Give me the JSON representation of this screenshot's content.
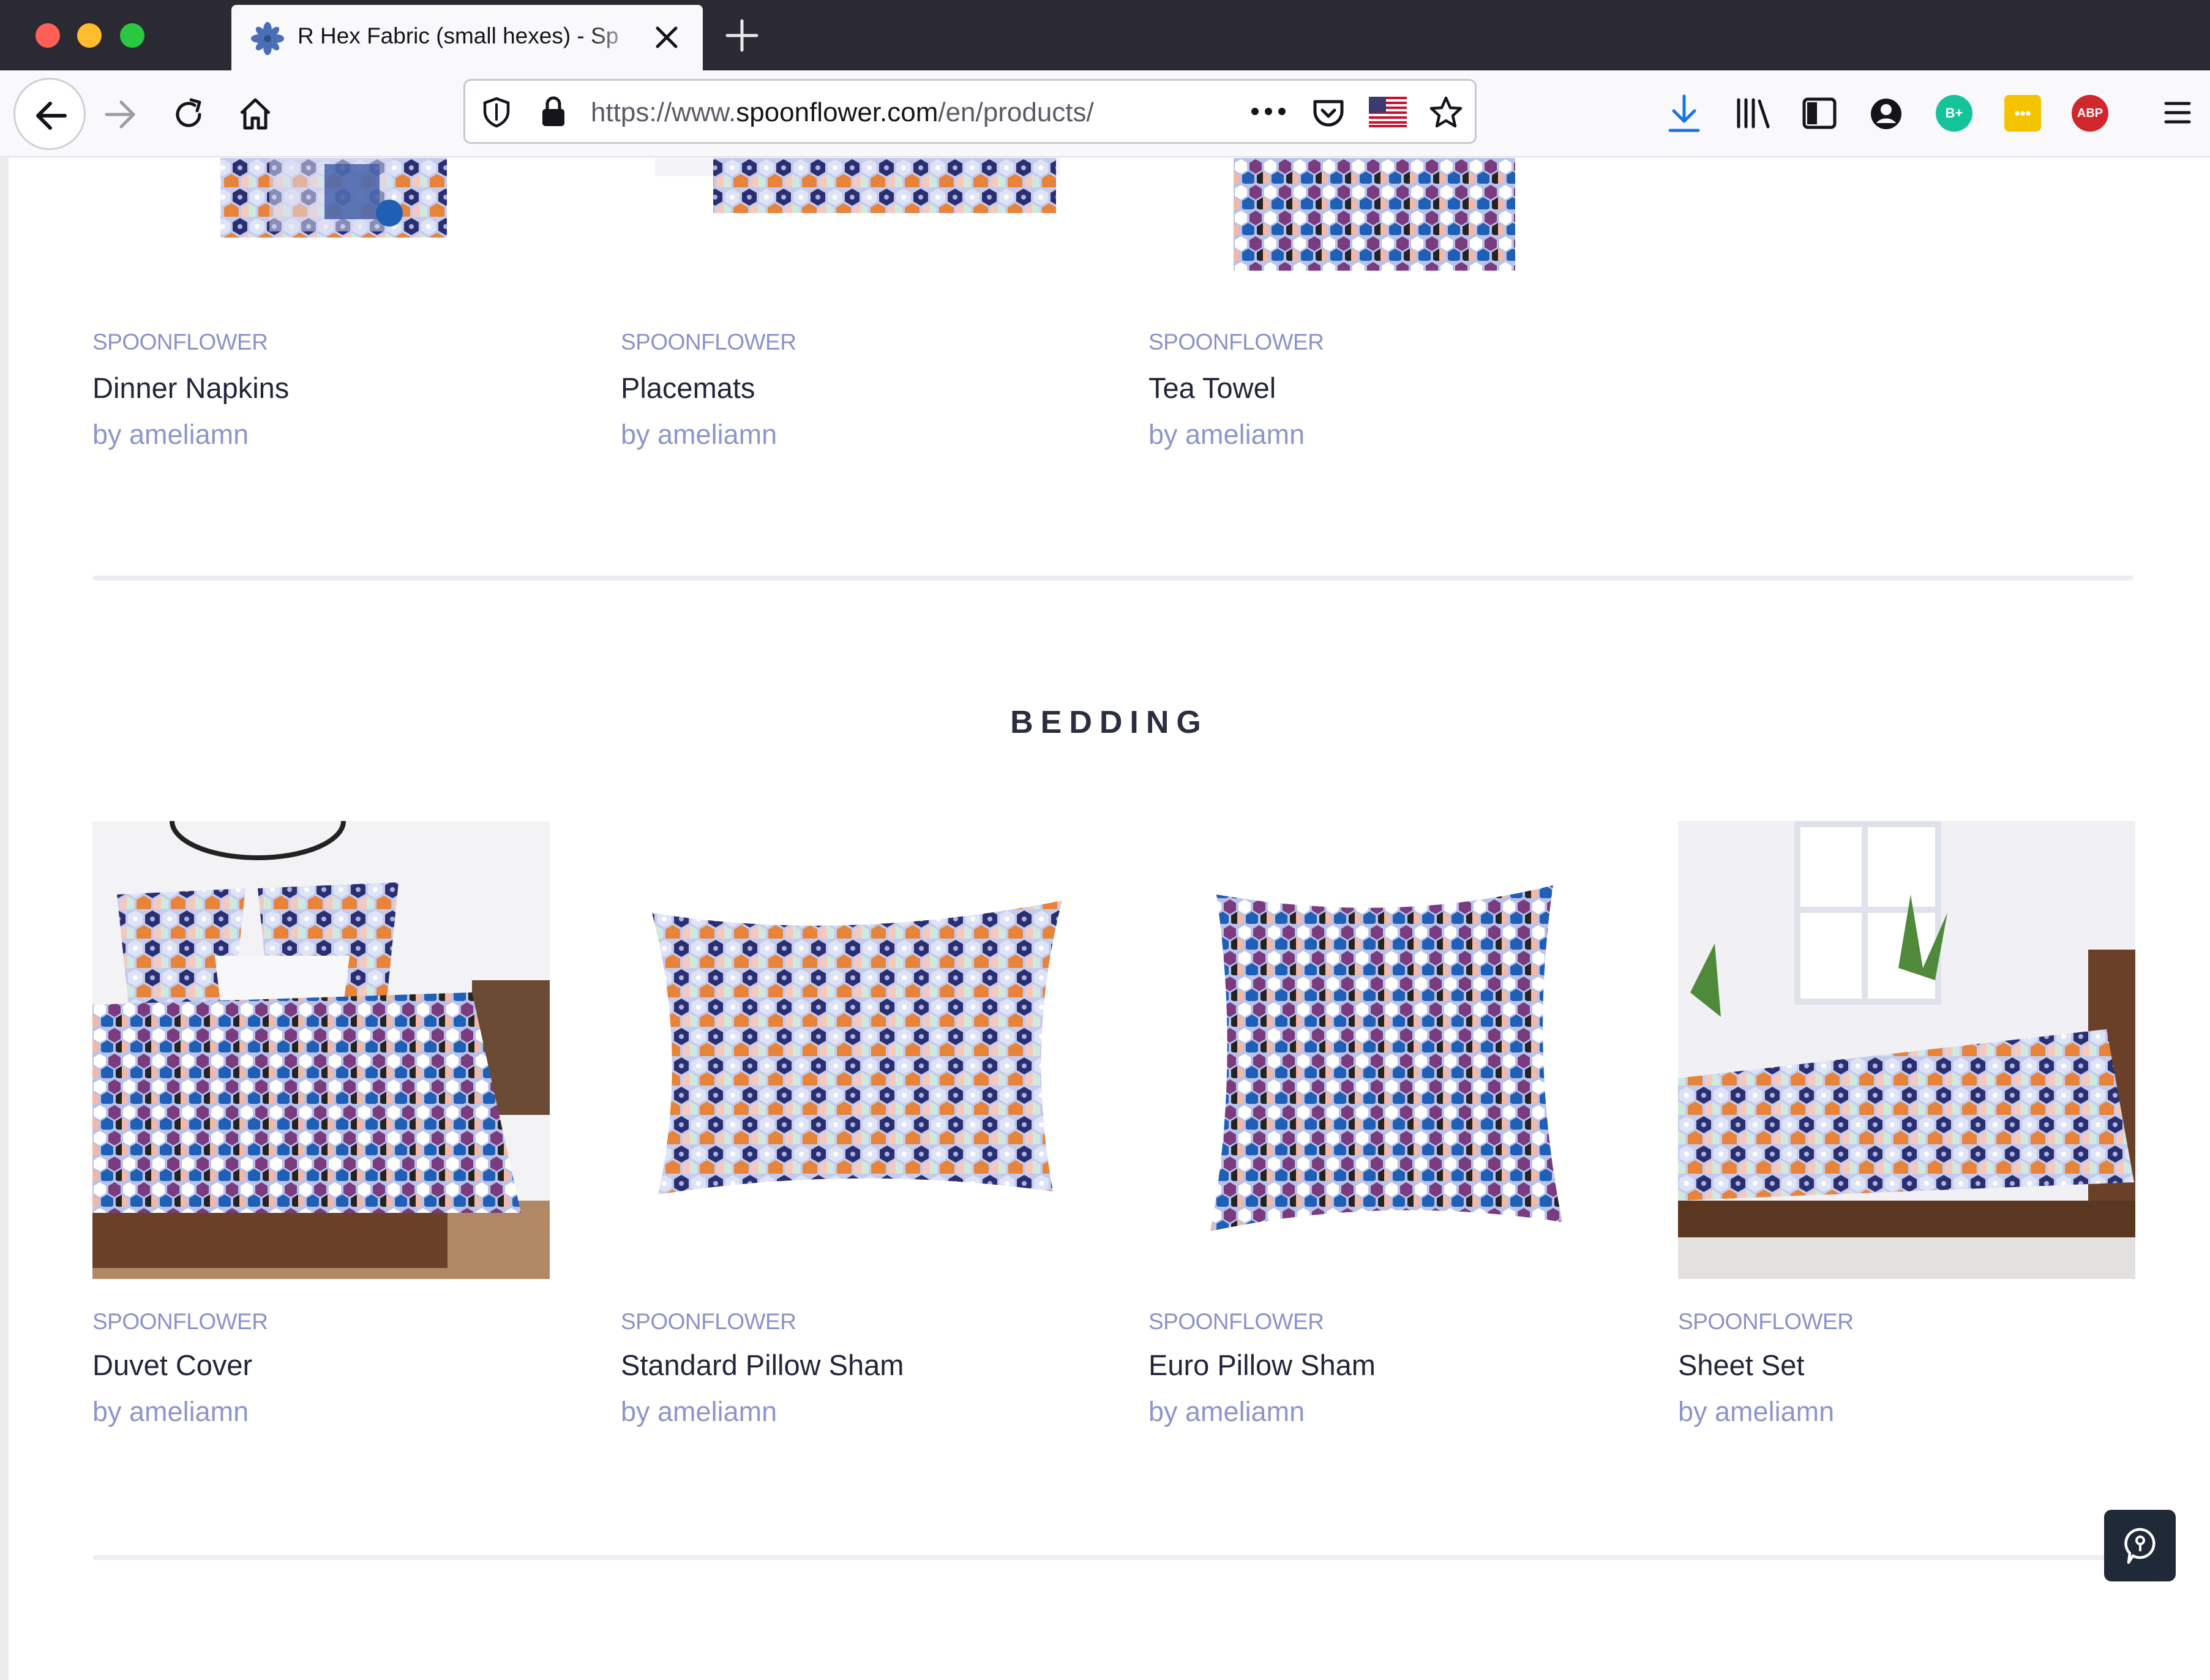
{
  "browser": {
    "tab_title": "R Hex Fabric (small hexes) - Sp",
    "url_scheme": "https://www.",
    "url_host": "spoonflower.com",
    "url_path": "/en/products/",
    "badges": {
      "grammarly": "B+",
      "abp": "ABP"
    }
  },
  "colors": {
    "brand_label": "#8a93c8",
    "product_name": "#23263b",
    "byline": "#8d96c9",
    "hex_palette": [
      "#a9b4e6",
      "#c6ccef",
      "#dfe3f6",
      "#f6c9c0",
      "#cfe9de",
      "#2b2f70",
      "#e8833a",
      "#7a3b7f",
      "#1f5fb5",
      "#242424",
      "#ffffff",
      "#f2b8a8"
    ]
  },
  "top_row": [
    {
      "brand": "SPOONFLOWER",
      "name": "Dinner Napkins",
      "by": "by ameliamn"
    },
    {
      "brand": "SPOONFLOWER",
      "name": "Placemats",
      "by": "by ameliamn"
    },
    {
      "brand": "SPOONFLOWER",
      "name": "Tea Towel",
      "by": "by ameliamn"
    }
  ],
  "bedding": {
    "title": "BEDDING",
    "items": [
      {
        "brand": "SPOONFLOWER",
        "name": "Duvet Cover",
        "by": "by ameliamn"
      },
      {
        "brand": "SPOONFLOWER",
        "name": "Standard Pillow Sham",
        "by": "by ameliamn"
      },
      {
        "brand": "SPOONFLOWER",
        "name": "Euro Pillow Sham",
        "by": "by ameliamn"
      },
      {
        "brand": "SPOONFLOWER",
        "name": "Sheet Set",
        "by": "by ameliamn"
      }
    ]
  }
}
